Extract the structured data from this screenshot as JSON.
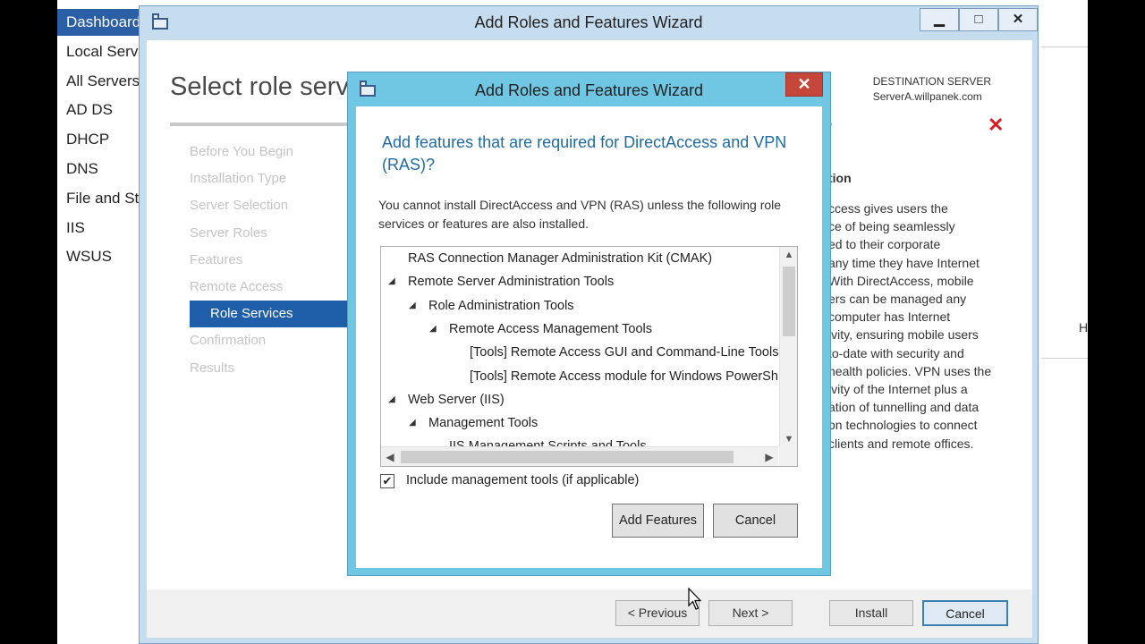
{
  "server_manager": {
    "nav": [
      "Dashboard",
      "Local Server",
      "All Servers",
      "AD DS",
      "DHCP",
      "DNS",
      "File and Storage Services",
      "IIS",
      "WSUS"
    ],
    "right_partial": "H"
  },
  "wizard": {
    "window_title": "Add Roles and Features Wizard",
    "window_buttons": {
      "minimize": "▁",
      "maximize": "□",
      "close": "✕"
    },
    "page_title": "Select role services",
    "destination_label": "DESTINATION SERVER",
    "destination_server": "ServerA.willpanek.com",
    "steps": [
      "Before You Begin",
      "Installation Type",
      "Server Selection",
      "Server Roles",
      "Features",
      "Remote Access",
      "Role Services",
      "Confirmation",
      "Results"
    ],
    "current_step_index": 6,
    "description_title": "tion",
    "description_lines": [
      "ccess gives users the",
      "ce of being seamlessly",
      "ed to their corporate",
      "any time they have Internet",
      "With DirectAccess, mobile",
      "ers can be managed any",
      "computer has Internet",
      "ivity, ensuring mobile users",
      "to-date with security and",
      "health policies. VPN uses the",
      "ivity of the Internet plus a",
      "ation of tunnelling and data",
      "on technologies to connect",
      "clients and remote offices."
    ],
    "buttons": {
      "previous": "< Previous",
      "next": "Next >",
      "install": "Install",
      "cancel": "Cancel"
    }
  },
  "dialog": {
    "title": "Add Roles and Features Wizard",
    "close_label": "✕",
    "heading": "Add features that are required for DirectAccess and VPN (RAS)?",
    "message": "You cannot install DirectAccess and VPN (RAS) unless the following role services or features are also installed.",
    "tree": [
      {
        "label": "RAS Connection Manager Administration Kit (CMAK)",
        "level": 0,
        "expanded": null
      },
      {
        "label": "Remote Server Administration Tools",
        "level": 0,
        "expanded": true
      },
      {
        "label": "Role Administration Tools",
        "level": 1,
        "expanded": true
      },
      {
        "label": "Remote Access Management Tools",
        "level": 2,
        "expanded": true
      },
      {
        "label": "[Tools] Remote Access GUI and Command-Line Tools",
        "level": 3,
        "expanded": null
      },
      {
        "label": "[Tools] Remote Access module for Windows PowerShell",
        "level": 3,
        "expanded": null
      },
      {
        "label": "Web Server (IIS)",
        "level": 0,
        "expanded": true
      },
      {
        "label": "Management Tools",
        "level": 1,
        "expanded": true
      },
      {
        "label": "IIS Management Scripts and Tools",
        "level": 2,
        "expanded": null
      }
    ],
    "include_tools_label": "Include management tools (if applicable)",
    "include_tools_checked": true,
    "add_features_label": "Add Features",
    "cancel_label": "Cancel"
  },
  "colors": {
    "nav_active": "#2a5ea5",
    "step_current": "#1f5ea8",
    "dialog_frame": "#6fc7e3",
    "dialog_heading": "#1f6ba1",
    "close_red": "#c7463a",
    "error_x": "#d42020"
  }
}
